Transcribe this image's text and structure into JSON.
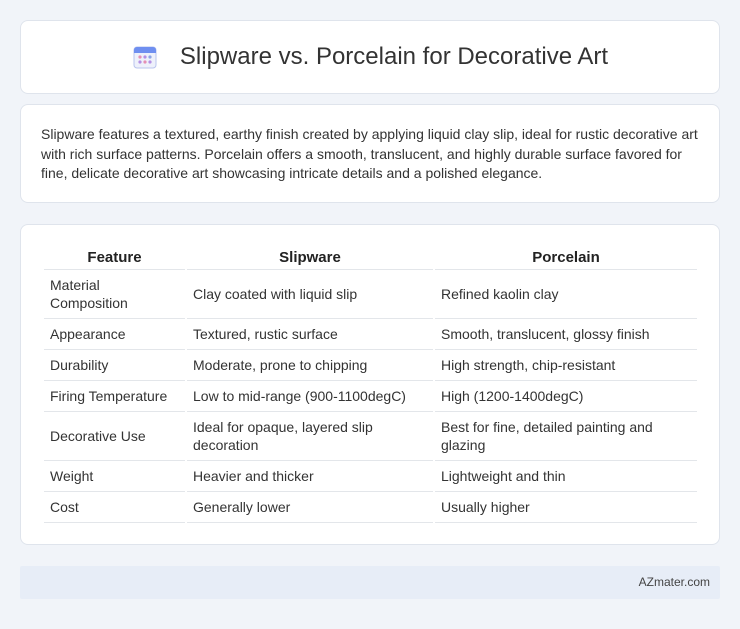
{
  "header": {
    "title": "Slipware vs. Porcelain for Decorative Art",
    "icon": "calendar-icon",
    "icon_color": "#5b8def"
  },
  "summary": {
    "text": "Slipware features a textured, earthy finish created by applying liquid clay slip, ideal for rustic decorative art with rich surface patterns. Porcelain offers a smooth, translucent, and highly durable surface favored for fine, delicate decorative art showcasing intricate details and a polished elegance."
  },
  "table": {
    "headers": [
      "Feature",
      "Slipware",
      "Porcelain"
    ],
    "rows": [
      [
        "Material Composition",
        "Clay coated with liquid slip",
        "Refined kaolin clay"
      ],
      [
        "Appearance",
        "Textured, rustic surface",
        "Smooth, translucent, glossy finish"
      ],
      [
        "Durability",
        "Moderate, prone to chipping",
        "High strength, chip-resistant"
      ],
      [
        "Firing Temperature",
        "Low to mid-range (900-1100degC)",
        "High (1200-1400degC)"
      ],
      [
        "Decorative Use",
        "Ideal for opaque, layered slip decoration",
        "Best for fine, detailed painting and glazing"
      ],
      [
        "Weight",
        "Heavier and thicker",
        "Lightweight and thin"
      ],
      [
        "Cost",
        "Generally lower",
        "Usually higher"
      ]
    ]
  },
  "footer": {
    "text": "AZmater.com"
  }
}
